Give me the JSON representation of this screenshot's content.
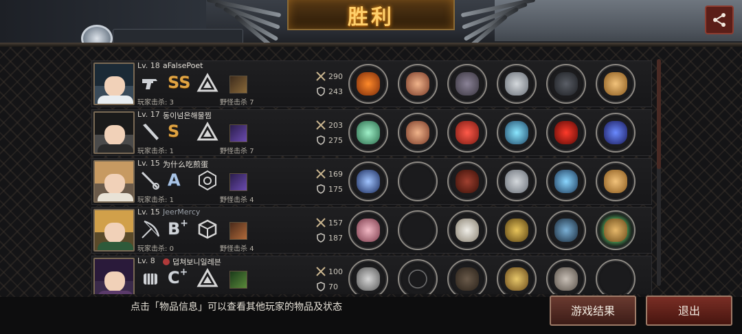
{
  "banner": {
    "title": "胜利"
  },
  "tip": "点击「物品信息」可以查看其他玩家的物品及状态",
  "buttons": {
    "result": "游戏结果",
    "exit": "退出"
  },
  "labels": {
    "player_kills": "玩家击杀",
    "monster_kills": "野怪击杀"
  },
  "players": [
    {
      "level": "Lv. 18",
      "name": "aFalsePoet",
      "grade": "SS",
      "player_kills": "3",
      "monster_kills": "7",
      "atk": "290",
      "def": "243",
      "weapon": "pistol-icon",
      "skill": "triangle-icon",
      "perk": "claw-icon"
    },
    {
      "level": "Lv. 17",
      "name": "동이넘은해물찜",
      "grade": "S",
      "player_kills": "1",
      "monster_kills": "7",
      "atk": "203",
      "def": "275",
      "weapon": "bat-icon",
      "skill": "triangle-icon",
      "perk": "purple-beast-icon"
    },
    {
      "level": "Lv. 15",
      "name": "为什么吃煎蛋",
      "grade": "A",
      "player_kills": "1",
      "monster_kills": "4",
      "atk": "169",
      "def": "175",
      "weapon": "rapier-icon",
      "skill": "hex-gear-icon",
      "perk": "purple-beast-icon"
    },
    {
      "level": "Lv. 15",
      "name": "JeerMercy",
      "grade": "B",
      "grade_sup": "+",
      "player_kills": "0",
      "monster_kills": "4",
      "atk": "157",
      "def": "187",
      "weapon": "bow-icon",
      "skill": "cube-icon",
      "perk": "cross-blade-icon"
    },
    {
      "level": "Lv. 8",
      "name": "덥쳐보니일레븐",
      "grade": "C",
      "grade_sup": "+",
      "player_kills": "",
      "monster_kills": "",
      "atk": "100",
      "def": "70",
      "weapon": "fist-icon",
      "skill": "triangle-icon",
      "perk": "green-icon"
    }
  ]
}
